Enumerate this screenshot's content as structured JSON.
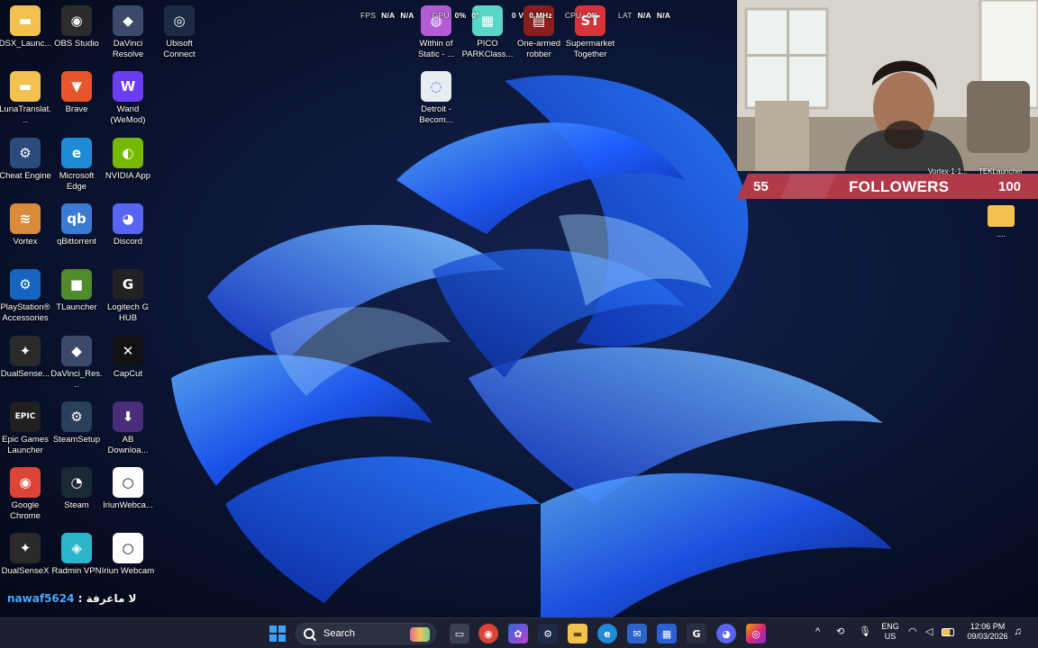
{
  "desktop": {
    "icons": [
      {
        "label": "DSX_Launc...",
        "icon": "folder-icon",
        "color": "#f2c14e",
        "glyph": "▬"
      },
      {
        "label": "OBS Studio",
        "icon": "obs-icon",
        "color": "#2c2c2c",
        "glyph": "◉"
      },
      {
        "label": "DaVinci Resolve",
        "icon": "davinci-icon",
        "color": "#3b4a6b",
        "glyph": "◆"
      },
      {
        "label": "Ubisoft Connect",
        "icon": "ubisoft-icon",
        "color": "#1e2a44",
        "glyph": "◎"
      },
      {
        "label": "LunaTranslat...",
        "icon": "folder-icon",
        "color": "#f2c14e",
        "glyph": "▬"
      },
      {
        "label": "Brave",
        "icon": "brave-icon",
        "color": "#e8552a",
        "glyph": "▼"
      },
      {
        "label": "Wand (WeMod)",
        "icon": "wand-icon",
        "color": "#6b3cf0",
        "glyph": "W"
      },
      {
        "label": "Cheat Engine",
        "icon": "cheat-engine-icon",
        "color": "#2a4b7c",
        "glyph": "⚙"
      },
      {
        "label": "Microsoft Edge",
        "icon": "edge-icon",
        "color": "#1f8bd6",
        "glyph": "e"
      },
      {
        "label": "NVIDIA App",
        "icon": "nvidia-icon",
        "color": "#76b900",
        "glyph": "◐"
      },
      {
        "label": "Vortex",
        "icon": "vortex-icon",
        "color": "#d98a3a",
        "glyph": "≋"
      },
      {
        "label": "qBittorrent",
        "icon": "qbittorrent-icon",
        "color": "#3a7bd5",
        "glyph": "qb"
      },
      {
        "label": "Discord",
        "icon": "discord-icon",
        "color": "#5865f2",
        "glyph": "◕"
      },
      {
        "label": "PlayStation® Accessories",
        "icon": "playstation-icon",
        "color": "#1565c0",
        "glyph": "⚙"
      },
      {
        "label": "TLauncher",
        "icon": "tlauncher-icon",
        "color": "#4f8a2b",
        "glyph": "■"
      },
      {
        "label": "Logitech G HUB",
        "icon": "logitech-icon",
        "color": "#222222",
        "glyph": "G"
      },
      {
        "label": "DualSense...",
        "icon": "dualsense-icon",
        "color": "#2a2a2a",
        "glyph": "✦"
      },
      {
        "label": "DaVinci_Res...",
        "icon": "davinci-icon",
        "color": "#3b4a6b",
        "glyph": "◆"
      },
      {
        "label": "CapCut",
        "icon": "capcut-icon",
        "color": "#111111",
        "glyph": "✕"
      },
      {
        "label": "Epic Games Launcher",
        "icon": "epic-games-icon",
        "color": "#202020",
        "glyph": "EPIC"
      },
      {
        "label": "SteamSetup",
        "icon": "steam-setup-icon",
        "color": "#2a3f5a",
        "glyph": "⚙"
      },
      {
        "label": "AB Downloa...",
        "icon": "ab-download-icon",
        "color": "#4a2d7a",
        "glyph": "⬇"
      },
      {
        "label": "Google Chrome",
        "icon": "chrome-icon",
        "color": "#db4437",
        "glyph": "◉"
      },
      {
        "label": "Steam",
        "icon": "steam-icon",
        "color": "#1b2838",
        "glyph": "◔"
      },
      {
        "label": "IriunWebca...",
        "icon": "iriun-icon",
        "color": "#ffffff",
        "glyph": "○"
      },
      {
        "label": "DualSenseX",
        "icon": "dualsense-icon",
        "color": "#2a2a2a",
        "glyph": "✦"
      },
      {
        "label": "Radmin VPN",
        "icon": "radmin-icon",
        "color": "#2bb5c9",
        "glyph": "◈"
      },
      {
        "label": "Iriun Webcam",
        "icon": "iriun-icon",
        "color": "#ffffff",
        "glyph": "○"
      }
    ],
    "top_icons": [
      {
        "label": "Within of Static - ...",
        "icon": "within-static-icon",
        "color": "#b45cd6",
        "glyph": "◍"
      },
      {
        "label": "PICO PARKClass...",
        "icon": "pico-park-icon",
        "color": "#5ad6c8",
        "glyph": "▦"
      },
      {
        "label": "One-armed robber",
        "icon": "one-armed-robber-icon",
        "color": "#8a1e1e",
        "glyph": "▤"
      },
      {
        "label": "Supermarket Together",
        "icon": "supermarket-icon",
        "color": "#d6333a",
        "glyph": "ST"
      },
      {
        "label": "Detroit - Becom...",
        "icon": "detroit-icon",
        "color": "#e8edf2",
        "glyph": "◌"
      }
    ],
    "right_folder": {
      "label": "....",
      "icon": "folder-icon",
      "color": "#f2c14e"
    }
  },
  "overlay": {
    "fps_label": "FPS",
    "fps_value": "N/A",
    "fps_value2": "N/A",
    "gpu_label": "GPU",
    "gpu_value": "0%",
    "val3": "0°",
    "val4": "0 V",
    "val5": "0 MHz",
    "cpu_label": "CPU",
    "cpu_value": "0%",
    "lat_label": "LAT",
    "lat_value": "N/A",
    "lat_value2": "N/A"
  },
  "stream": {
    "followers_left": "55",
    "followers_title": "FOLLOWERS",
    "followers_right": "100",
    "label_vortex": "Vortex-1-1...",
    "label_tek": "TEKLauncher",
    "bar_color": "#b23a48"
  },
  "chat": {
    "username": "nawaf5624",
    "separator": ":",
    "message": "لا ماعرفة"
  },
  "taskbar": {
    "search_placeholder": "Search",
    "language": "ENG",
    "region": "US",
    "time": "12:06 PM",
    "date": "09/03/2026",
    "chevron": "^"
  }
}
